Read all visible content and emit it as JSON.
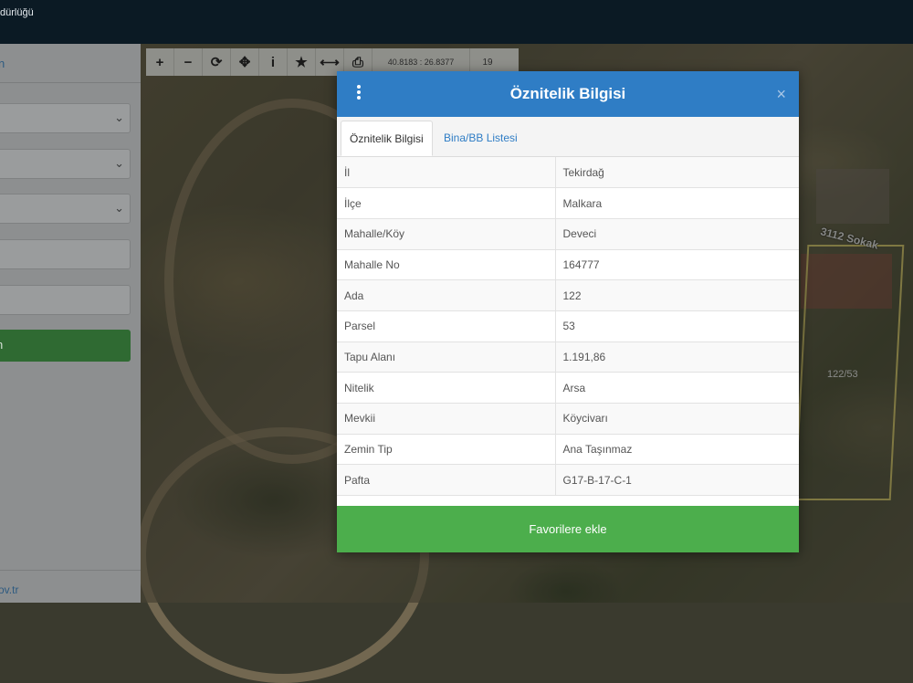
{
  "header": {
    "brand_fragment": "dürlüğü"
  },
  "side_panel": {
    "head_link": "n",
    "button_label": "n",
    "footer_text": "ov.tr"
  },
  "toolbar": {
    "zoom_in": "+",
    "zoom_out": "−",
    "refresh": "⟳",
    "pan": "✥",
    "info": "i",
    "favorite": "★",
    "measure": "⟷",
    "print": "⎙",
    "coords": "40.8183 : 26.8377",
    "zoom_level": "19"
  },
  "map": {
    "street_label": "3112 Sokak",
    "parcel_label": "122/53"
  },
  "modal": {
    "title": "Öznitelik Bilgisi",
    "close": "×",
    "tabs": [
      {
        "label": "Öznitelik Bilgisi"
      },
      {
        "label": "Bina/BB Listesi"
      }
    ],
    "rows": [
      {
        "key": "İl",
        "value": "Tekirdağ"
      },
      {
        "key": "İlçe",
        "value": "Malkara"
      },
      {
        "key": "Mahalle/Köy",
        "value": "Deveci"
      },
      {
        "key": "Mahalle No",
        "value": "164777"
      },
      {
        "key": "Ada",
        "value": "122"
      },
      {
        "key": "Parsel",
        "value": "53"
      },
      {
        "key": "Tapu Alanı",
        "value": "1.191,86"
      },
      {
        "key": "Nitelik",
        "value": "Arsa"
      },
      {
        "key": "Mevkii",
        "value": "Köycivarı"
      },
      {
        "key": "Zemin Tip",
        "value": "Ana Taşınmaz"
      },
      {
        "key": "Pafta",
        "value": "G17-B-17-C-1"
      }
    ],
    "favorite_button": "Favorilere ekle"
  },
  "colors": {
    "header_blue": "#2f7dc5",
    "button_green": "#4cae4c",
    "topbar": "#0b1a24"
  }
}
